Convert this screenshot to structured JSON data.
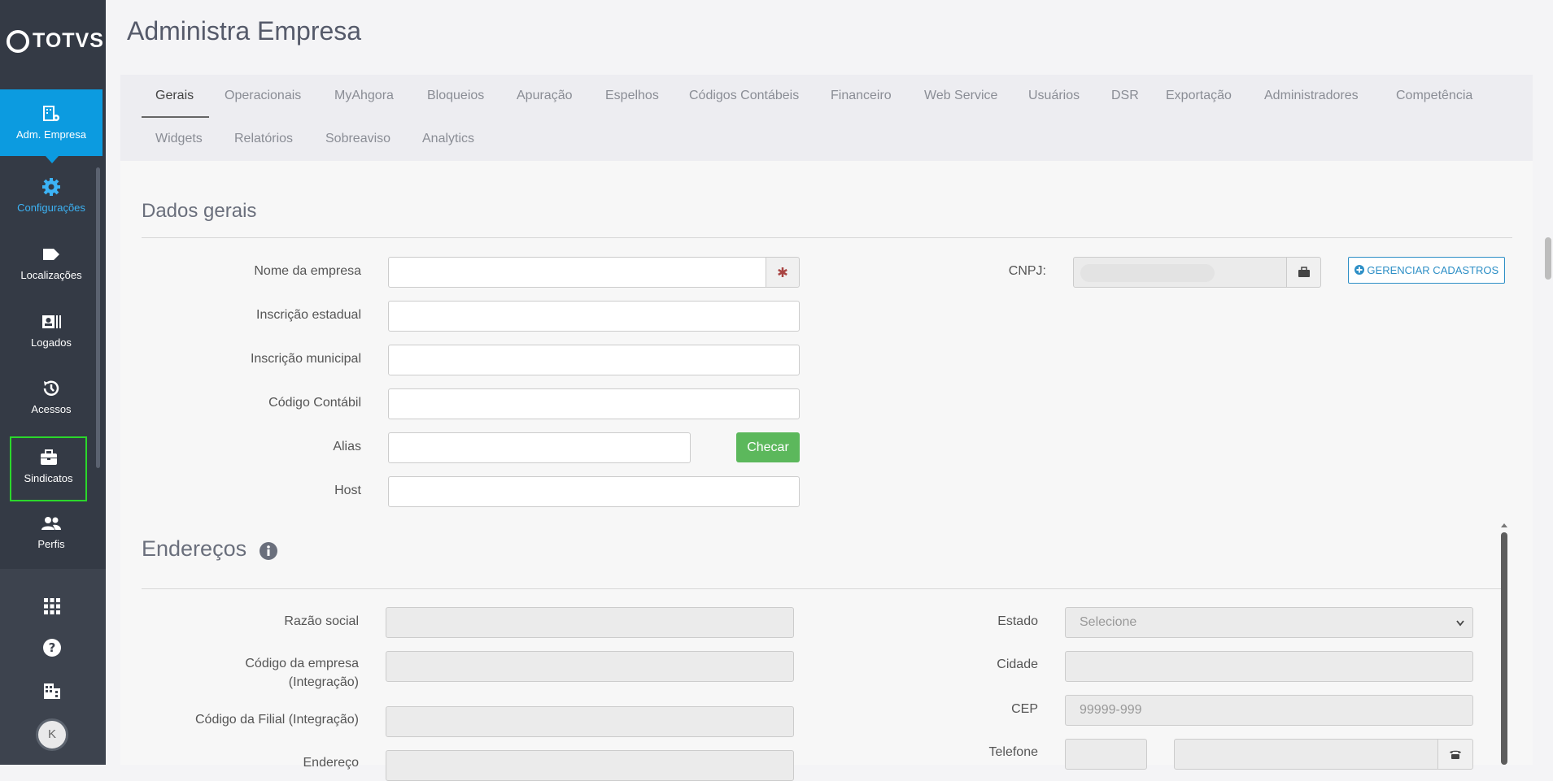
{
  "app": {
    "logo_text": "TOTVS",
    "page_title": "Administra Empresa"
  },
  "sidebar": {
    "items": [
      {
        "label": "Adm. Empresa",
        "icon": "company-settings-icon"
      },
      {
        "label": "Configurações",
        "icon": "gear-icon"
      },
      {
        "label": "Localizações",
        "icon": "tag-icon"
      },
      {
        "label": "Logados",
        "icon": "id-card-icon"
      },
      {
        "label": "Acessos",
        "icon": "history-icon"
      },
      {
        "label": "Sindicatos",
        "icon": "briefcase-icon"
      },
      {
        "label": "Perfis",
        "icon": "users-icon"
      }
    ],
    "bottom_icons": [
      "apps-grid-icon",
      "help-icon",
      "building-icon"
    ],
    "avatar_initial": "K"
  },
  "tabs": {
    "row1": [
      "Gerais",
      "Operacionais",
      "MyAhgora",
      "Bloqueios",
      "Apuração",
      "Espelhos",
      "Códigos Contábeis",
      "Financeiro",
      "Web Service",
      "Usuários",
      "DSR",
      "Exportação",
      "Administradores",
      "Competência"
    ],
    "row2": [
      "Widgets",
      "Relatórios",
      "Sobreaviso",
      "Analytics"
    ],
    "active": "Gerais"
  },
  "dados_gerais": {
    "title": "Dados gerais",
    "fields": {
      "nome_empresa": {
        "label": "Nome da empresa",
        "value": ""
      },
      "inscricao_estadual": {
        "label": "Inscrição estadual",
        "value": ""
      },
      "inscricao_municipal": {
        "label": "Inscrição municipal",
        "value": ""
      },
      "codigo_contabil": {
        "label": "Código Contábil",
        "value": ""
      },
      "alias": {
        "label": "Alias",
        "value": ""
      },
      "host": {
        "label": "Host",
        "value": ""
      },
      "cnpj": {
        "label": "CNPJ:",
        "value": ""
      }
    },
    "checar_label": "Checar",
    "gerenciar_label": "GERENCIAR CADASTROS"
  },
  "enderecos": {
    "title": "Endereços",
    "fields": {
      "razao_social": {
        "label": "Razão social"
      },
      "codigo_empresa": {
        "label_1": "Código da empresa",
        "label_2": "(Integração)"
      },
      "codigo_filial": {
        "label": "Código da Filial (Integração)"
      },
      "endereco": {
        "label": "Endereço"
      },
      "estado": {
        "label": "Estado",
        "selected": "Selecione"
      },
      "cidade": {
        "label": "Cidade"
      },
      "cep": {
        "label": "CEP",
        "placeholder": "99999-999"
      },
      "telefone": {
        "label": "Telefone"
      }
    }
  },
  "colors": {
    "sidebar": "#343a45",
    "active_nav": "#0c9be0",
    "highlight": "#2bd72b",
    "checar": "#5cb85c",
    "link": "#2d8fc6"
  }
}
